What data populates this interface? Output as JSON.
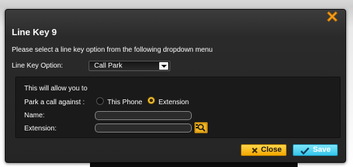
{
  "dialog": {
    "title": "Line Key 9",
    "instruction": "Please select a line key option from the following dropdown menu",
    "option_label": "Line Key Option:",
    "option_value": "Call Park"
  },
  "panel": {
    "heading": "This will allow you to",
    "park_label": "Park a call against :",
    "radio_this_phone": "This Phone",
    "radio_extension": "Extension",
    "selected_radio": "Extension",
    "name_label": "Name:",
    "name_value": "",
    "extension_label": "Extension:",
    "extension_value": ""
  },
  "buttons": {
    "close_label": "Close",
    "save_label": "Save"
  },
  "colors": {
    "accent_orange": "#f4a700",
    "accent_cyan": "#34c5ea",
    "dialog_bg": "#2a2a2a"
  },
  "icons": {
    "dialog_close": "close-x-icon",
    "lookup": "search-icon",
    "close_button": "x-icon",
    "save_button": "checkmark-icon"
  }
}
